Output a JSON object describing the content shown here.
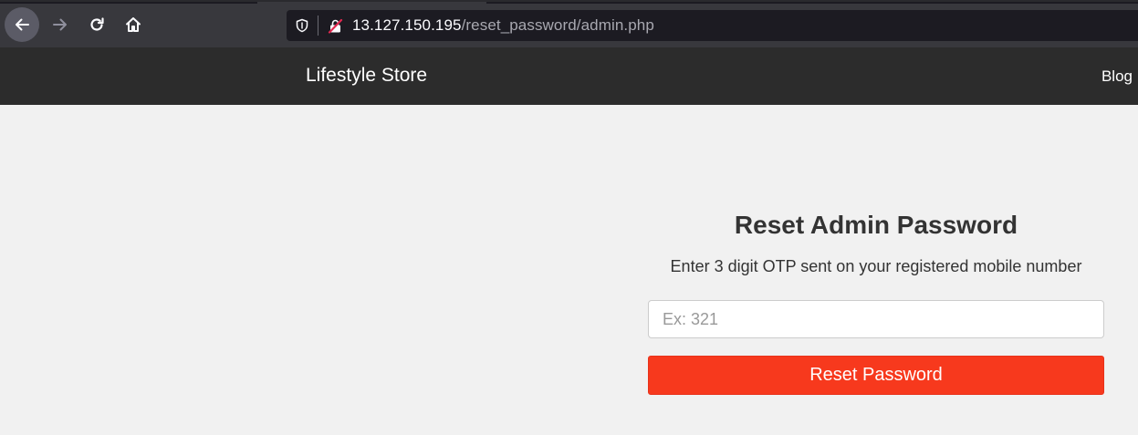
{
  "browser": {
    "url_host": "13.127.150.195",
    "url_path": "/reset_password/admin.php",
    "icons": {
      "back": "arrow-left-icon",
      "forward": "arrow-right-icon",
      "reload": "reload-icon",
      "home": "home-icon",
      "tracking": "shield-icon",
      "insecure": "insecure-lock-icon"
    }
  },
  "navbar": {
    "brand": "Lifestyle Store",
    "links": [
      {
        "label": "Blog"
      }
    ]
  },
  "form": {
    "title": "Reset Admin Password",
    "instruction": "Enter 3 digit OTP sent on your registered mobile number",
    "otp_value": "",
    "otp_placeholder": "Ex: 321",
    "submit_label": "Reset Password"
  },
  "colors": {
    "navbar_bg": "#2c2c2c",
    "page_bg": "#f1f1f1",
    "button_bg": "#f7391d",
    "browser_chrome": "#38383d",
    "url_bar_bg": "#1c1b22"
  }
}
